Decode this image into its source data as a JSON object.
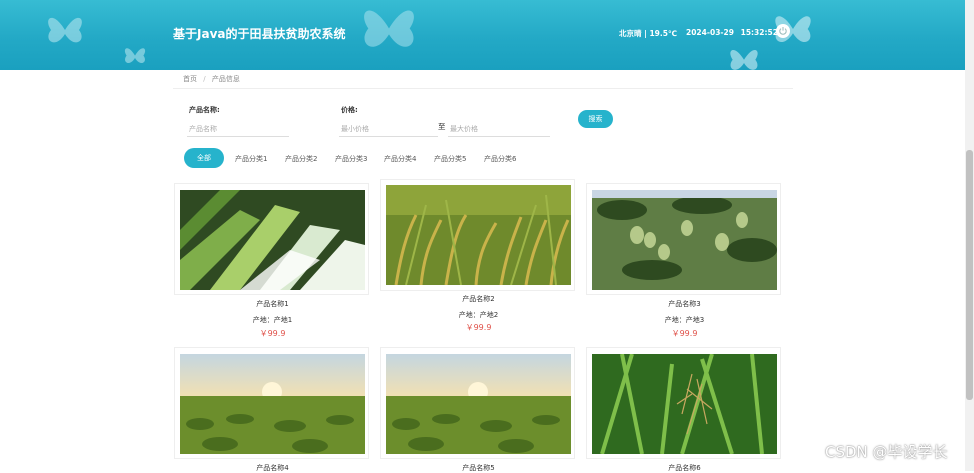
{
  "header": {
    "title": "基于Java的于田县扶贫助农系统",
    "weather": "北京晴 | 19.5℃",
    "date": "2024-03-29",
    "time": "15:32:52",
    "background_color": "#23a9c6"
  },
  "breadcrumb": {
    "home": "首页",
    "separator": "/",
    "current": "产品信息"
  },
  "search": {
    "name_label": "产品名称:",
    "name_placeholder": "产品名称",
    "price_label": "价格:",
    "min_placeholder": "最小价格",
    "to_text": "至",
    "max_placeholder": "最大价格",
    "button_label": "搜索",
    "accent_color": "#26b3cc"
  },
  "categories": {
    "all": "全部",
    "items": [
      "产品分类1",
      "产品分类2",
      "产品分类3",
      "产品分类4",
      "产品分类5",
      "产品分类6"
    ]
  },
  "products": [
    {
      "name": "产品名称1",
      "origin": "产地：产地1",
      "price": "￥99.9",
      "image": "leek"
    },
    {
      "name": "产品名称2",
      "origin": "产地：产地2",
      "price": "￥99.9",
      "image": "rice"
    },
    {
      "name": "产品名称3",
      "origin": "产地：产地3",
      "price": "￥99.9",
      "image": "mango"
    },
    {
      "name": "产品名称4",
      "image": "field"
    },
    {
      "name": "产品名称5",
      "image": "field"
    },
    {
      "name": "产品名称6",
      "image": "rice-plant"
    }
  ],
  "price_color": "#e0524a",
  "watermark": "CSDN @毕设学长"
}
